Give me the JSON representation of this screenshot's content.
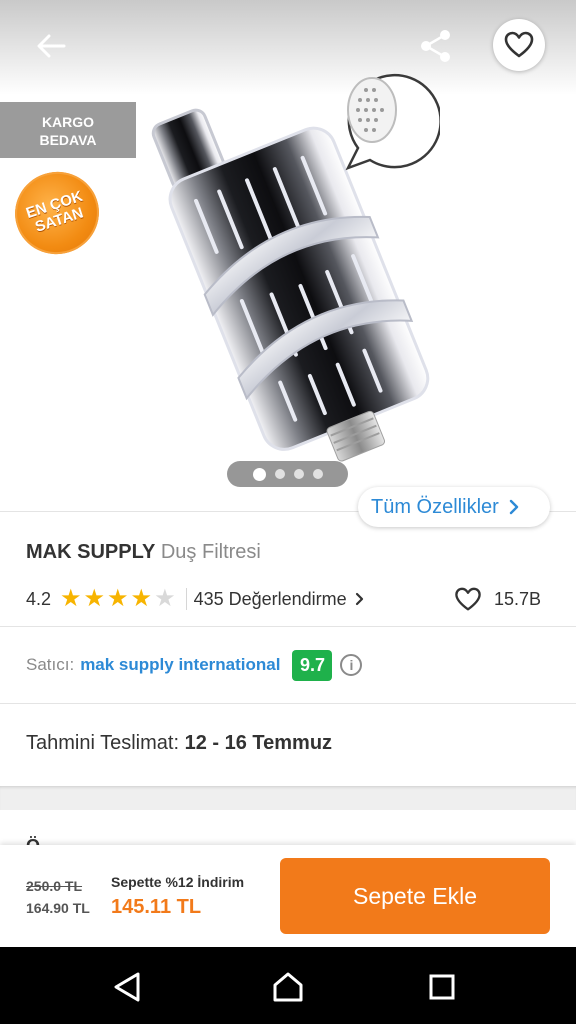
{
  "header": {
    "back_icon": "arrow-left-icon",
    "share_icon": "share-icon",
    "favorite_icon": "heart-outline-icon"
  },
  "badges": {
    "kargo_line1": "KARGO",
    "kargo_line2": "BEDAVA",
    "cok_satan_line1": "EN ÇOK",
    "cok_satan_line2": "SATAN"
  },
  "gallery": {
    "image_count": 4,
    "active_index": 0
  },
  "all_features_label": "Tüm Özellikler",
  "product": {
    "brand": "MAK SUPPLY",
    "name": "Duş Filtresi",
    "rating": "4.2",
    "rating_value": 4.2,
    "stars_filled": 4,
    "stars_total": 5,
    "reviews_label": "435 Değerlendirme",
    "favorites_count": "15.7B"
  },
  "seller": {
    "label": "Satıcı:",
    "name": "mak supply international",
    "score": "9.7"
  },
  "delivery": {
    "label": "Tahmini Teslimat:",
    "dates": "12 - 16 Temmuz"
  },
  "next_section_peek": "Ö... ...",
  "pricing": {
    "old_price": "250.0 TL",
    "price": "164.90 TL",
    "cart_discount_label": "Sepette %12 İndirim",
    "final_price": "145.11 TL",
    "add_to_cart_label": "Sepete Ekle"
  },
  "colors": {
    "accent_orange": "#f27a1a",
    "link_blue": "#2d8ad6",
    "score_green": "#1fb14b",
    "star_yellow": "#f7b400",
    "badge_gray": "#9b9b9b"
  },
  "system_nav": {
    "back_icon": "nav-back-triangle-icon",
    "home_icon": "nav-home-icon",
    "recents_icon": "nav-recents-square-icon"
  }
}
